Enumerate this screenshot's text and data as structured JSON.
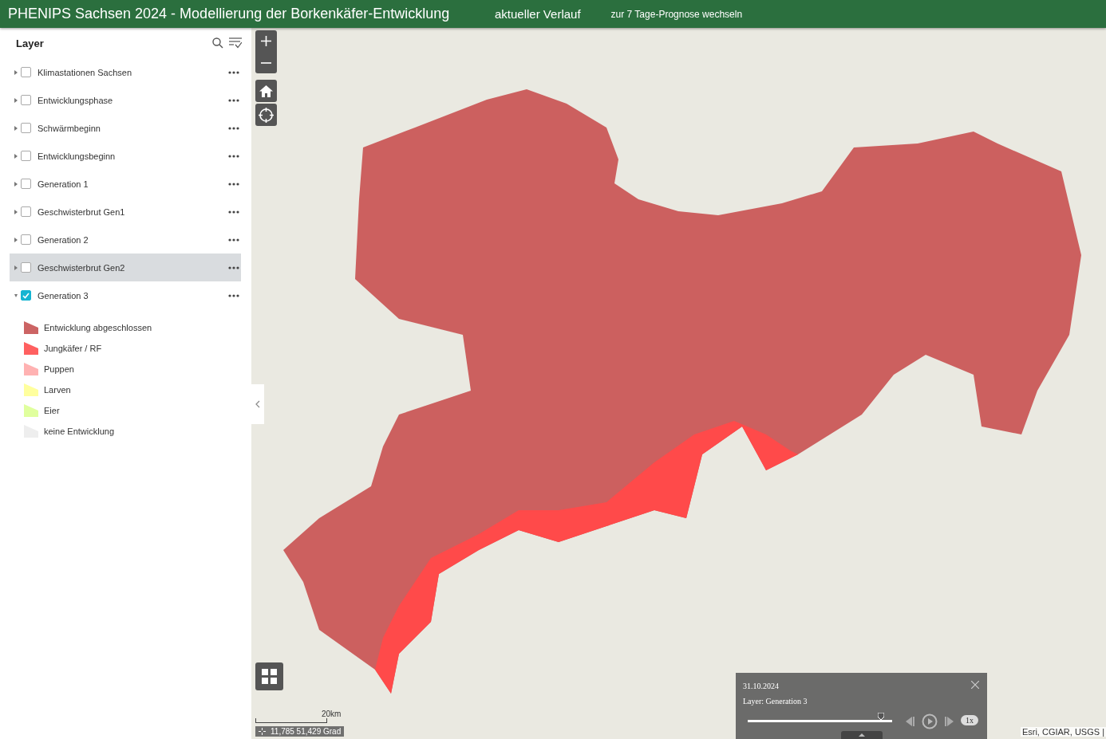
{
  "header": {
    "title": "PHENIPS Sachsen 2024 - Modellierung der Borkenkäfer-Entwicklung",
    "nav": [
      {
        "label": "aktueller Verlauf",
        "selected": true
      },
      {
        "label": "zur 7 Tage-Prognose wechseln",
        "selected": false
      }
    ]
  },
  "layer_panel": {
    "title": "Layer",
    "layers": [
      {
        "label": "Klimastationen Sachsen",
        "checked": false,
        "expanded": false,
        "selected": false
      },
      {
        "label": "Entwicklungsphase",
        "checked": false,
        "expanded": false,
        "selected": false
      },
      {
        "label": "Schwärmbeginn",
        "checked": false,
        "expanded": false,
        "selected": false
      },
      {
        "label": "Entwicklungsbeginn",
        "checked": false,
        "expanded": false,
        "selected": false
      },
      {
        "label": "Generation 1",
        "checked": false,
        "expanded": false,
        "selected": false
      },
      {
        "label": "Geschwisterbrut Gen1",
        "checked": false,
        "expanded": false,
        "selected": false
      },
      {
        "label": "Generation 2",
        "checked": false,
        "expanded": false,
        "selected": false
      },
      {
        "label": "Geschwisterbrut Gen2",
        "checked": false,
        "expanded": false,
        "selected": true
      },
      {
        "label": "Generation 3",
        "checked": true,
        "expanded": true,
        "selected": false,
        "legend": [
          {
            "label": "Entwicklung abgeschlossen",
            "color": "#cc6464"
          },
          {
            "label": "Jungkäfer / RF",
            "color": "#ff6060"
          },
          {
            "label": "Puppen",
            "color": "#ffb2b2"
          },
          {
            "label": "Larven",
            "color": "#ffff9e"
          },
          {
            "label": "Eier",
            "color": "#e0ff9e"
          },
          {
            "label": "keine Entwicklung",
            "color": "#eeeeee"
          }
        ]
      }
    ]
  },
  "map": {
    "scale": "20km",
    "coordinates": "11,785 51,429 Grad",
    "attribution": "Esri, CGIAR, USGS |"
  },
  "time_slider": {
    "date": "31.10.2024",
    "layer": "Layer: Generation 3",
    "level": 0.92,
    "speed": "1x"
  }
}
